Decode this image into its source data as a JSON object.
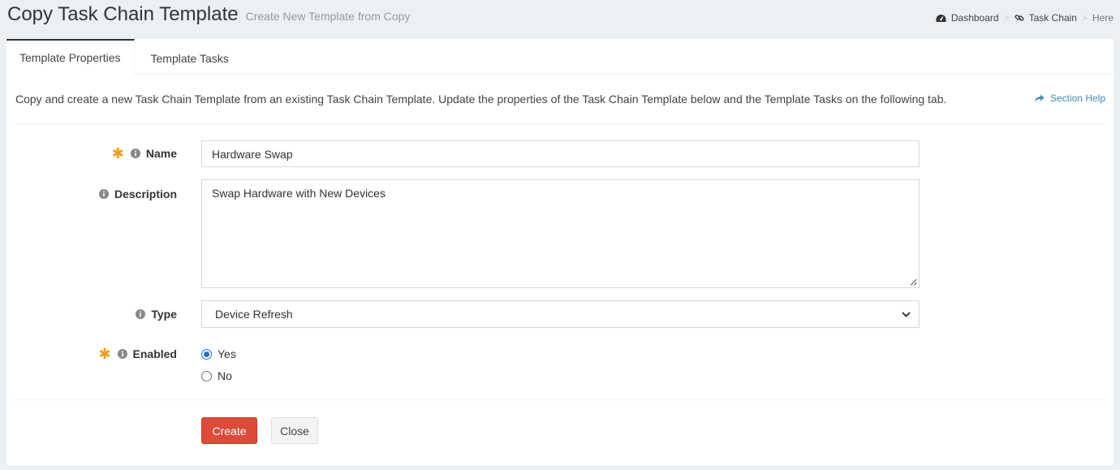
{
  "header": {
    "title": "Copy Task Chain Template",
    "subtitle": "Create New Template from Copy"
  },
  "breadcrumb": {
    "items": [
      "Dashboard",
      "Task Chain",
      "Here"
    ],
    "separator": ">"
  },
  "tabs": [
    {
      "label": "Template Properties",
      "active": true
    },
    {
      "label": "Template Tasks",
      "active": false
    }
  ],
  "intro_text": "Copy and create a new Task Chain Template from an existing Task Chain Template. Update the properties of the Task Chain Template below and the Template Tasks on the following tab.",
  "section_help": "Section Help",
  "form": {
    "name": {
      "label": "Name",
      "value": "Hardware Swap",
      "required": true
    },
    "description": {
      "label": "Description",
      "value": "Swap Hardware with New Devices"
    },
    "type": {
      "label": "Type",
      "value": "Device Refresh"
    },
    "enabled": {
      "label": "Enabled",
      "required": true,
      "options": [
        "Yes",
        "No"
      ],
      "selected": "Yes"
    }
  },
  "buttons": {
    "create": "Create",
    "close": "Close"
  },
  "colors": {
    "accent": "#3c8dbc",
    "danger": "#dd4b39",
    "required": "#f39c12"
  }
}
